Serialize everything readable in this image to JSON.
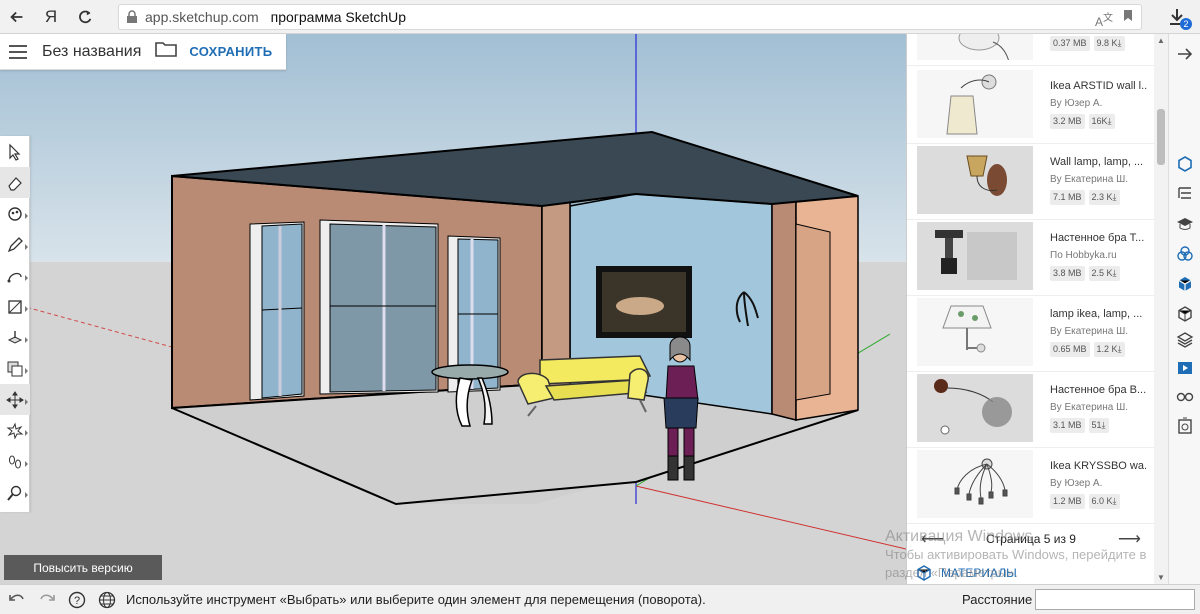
{
  "browser": {
    "yandex_logo": "Я",
    "domain": "app.sketchup.com",
    "title": "программа SketchUp",
    "download_badge": "2"
  },
  "app": {
    "file_name": "Без названия",
    "save_label": "СОХРАНИТЬ"
  },
  "upgrade_label": "Повысить версию",
  "panel": {
    "items": [
      {
        "name": "",
        "author": "",
        "size": "0.37 MB",
        "downloads": "9.8 K⤓"
      },
      {
        "name": "Ikea ARSTID wall l...",
        "author": "By Юзер А.",
        "size": "3.2 MB",
        "downloads": "16K⤓"
      },
      {
        "name": "Wall lamp, lamp, ...",
        "author": "By Екатерина Ш.",
        "size": "7.1 MB",
        "downloads": "2.3 K⤓"
      },
      {
        "name": "Настенное бра Т...",
        "author": "По Hobbyka.ru",
        "size": "3.8 MB",
        "downloads": "2.5 K⤓"
      },
      {
        "name": "lamp ikea, lamp, ...",
        "author": "By Екатерина Ш.",
        "size": "0.65 MB",
        "downloads": "1.2 K⤓"
      },
      {
        "name": "Настенное бра В...",
        "author": "By Екатерина Ш.",
        "size": "3.1 MB",
        "downloads": "51⤓"
      },
      {
        "name": "Ikea KRYSSBO wa...",
        "author": "By Юзер А.",
        "size": "1.2 MB",
        "downloads": "6.0 K⤓"
      }
    ],
    "page_label": "Страница 5 из 9",
    "materials_label": "МАТЕРИАЛЫ"
  },
  "watermark": {
    "line1": "Активация Windows",
    "line2": "Чтобы активировать Windows, перейдите в",
    "line3": "раздел «Параметры»."
  },
  "status": {
    "hint": "Используйте инструмент «Выбрать» или выберите один элемент для перемещения (поворота).",
    "distance_label": "Расстояние",
    "distance_value": ""
  },
  "icons": {
    "toolbar": [
      "select-icon",
      "eraser-icon",
      "paint-icon",
      "pencil-icon",
      "arc-icon",
      "rectangle-icon",
      "push-pull-icon",
      "offset-icon",
      "move-icon",
      "orbit-icon",
      "footprints-icon",
      "zoom-icon"
    ],
    "strip": [
      "arrow-right-icon",
      "component-icon",
      "outliner-icon",
      "instructor-icon",
      "entity-info-icon",
      "3d-warehouse-icon",
      "box-icon",
      "layers-icon",
      "scenes-icon",
      "glasses-icon",
      "display-icon"
    ]
  },
  "colors": {
    "accent": "#1f6db5",
    "sky": "#a9c4d8",
    "ground": "#d4d4d4",
    "wall_brick": "#b98a74",
    "wall_blue": "#9fc3d8",
    "sofa": "#f3ea60"
  }
}
